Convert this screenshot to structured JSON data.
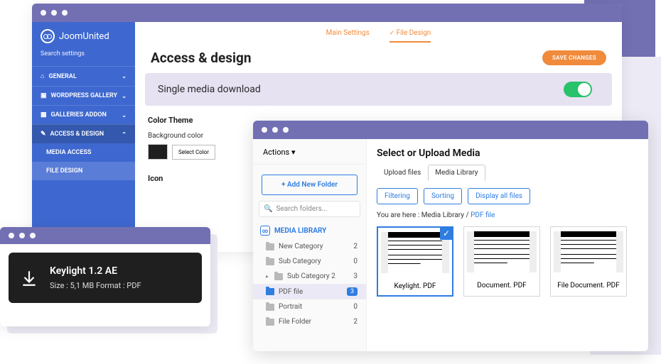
{
  "brand": "JoomUnited",
  "search_placeholder": "Search settings",
  "nav": {
    "general": "GENERAL",
    "wp_gallery": "WORDPRESS GALLERY",
    "galleries_addon": "GALLERIES ADDON",
    "access_design": "ACCESS & DESIGN",
    "media_access": "MEDIA ACCESS",
    "file_design": "FILE DESIGN"
  },
  "top_tabs": {
    "main": "Main Settings",
    "file_design": "File Design"
  },
  "page_title": "Access & design",
  "save": "SAVE CHANGES",
  "setting_download": "Single media download",
  "color_theme": {
    "title": "Color Theme",
    "bg": "Background color",
    "select": "Select Color"
  },
  "icon_section": "Icon",
  "media": {
    "actions": "Actions",
    "add_folder": "Add New Folder",
    "search_placeholder": "Search folders...",
    "library": "MEDIA LIBRARY",
    "folders": [
      {
        "label": "New Category",
        "count": "2"
      },
      {
        "label": "Sub Category",
        "count": "0"
      },
      {
        "label": "Sub Category 2",
        "count": "3",
        "caret": true
      },
      {
        "label": "PDF file",
        "count": "3",
        "selected": true
      },
      {
        "label": "Portrait",
        "count": "0"
      },
      {
        "label": "File Folder",
        "count": "2"
      }
    ],
    "heading": "Select or Upload Media",
    "inner_tabs": {
      "upload": "Upload files",
      "library": "Media Library"
    },
    "filters": {
      "filtering": "Filtering",
      "sorting": "Sorting",
      "all": "Display all files"
    },
    "crumb_prefix": "You are here : Media Library / ",
    "crumb_current": "PDF file",
    "files": [
      {
        "name": "Keylight. PDF",
        "selected": true
      },
      {
        "name": "Document. PDF"
      },
      {
        "name": "File Document. PDF"
      }
    ]
  },
  "download": {
    "title": "Keylight 1.2 AE",
    "meta": "Size : 5,1 MB Format : PDF"
  }
}
